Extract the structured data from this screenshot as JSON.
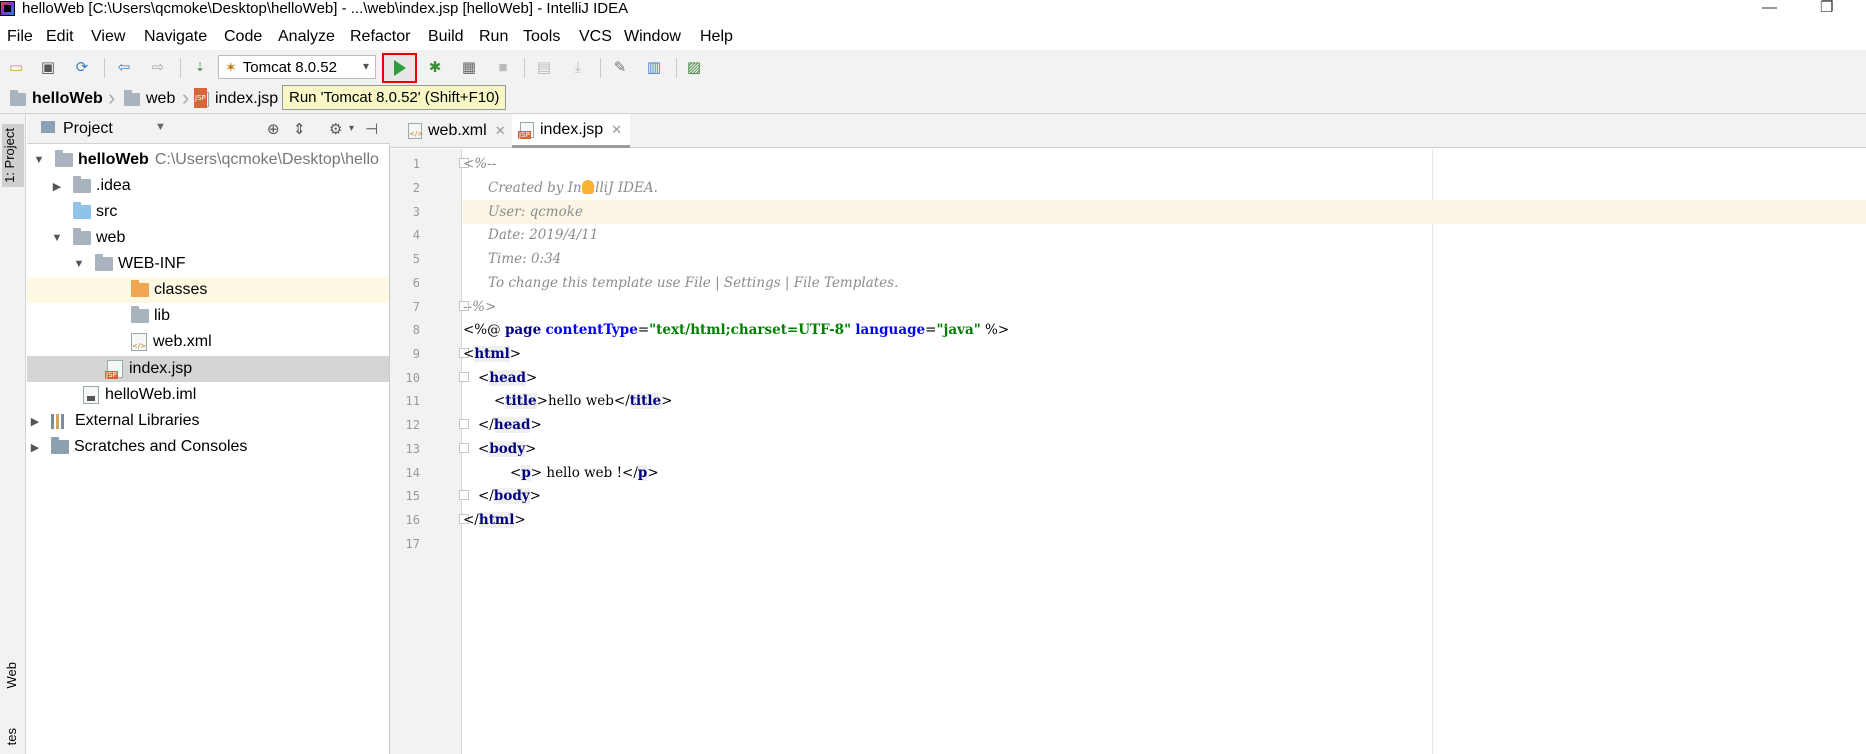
{
  "window": {
    "title": "helloWeb [C:\\Users\\qcmoke\\Desktop\\helloWeb] - ...\\web\\index.jsp [helloWeb] - IntelliJ IDEA",
    "minimize": "—",
    "restore": "❐"
  },
  "menu": [
    "File",
    "Edit",
    "View",
    "Navigate",
    "Code",
    "Analyze",
    "Refactor",
    "Build",
    "Run",
    "Tools",
    "VCS",
    "Window",
    "Help"
  ],
  "toolbar": {
    "run_config": "Tomcat 8.0.52",
    "tooltip": "Run 'Tomcat 8.0.52' (Shift+F10)"
  },
  "breadcrumb": [
    "helloWeb",
    "web",
    "index.jsp"
  ],
  "side_tabs": {
    "project": "1: Project",
    "web": "Web",
    "favorites": "tes"
  },
  "project_panel": {
    "title": "Project",
    "tree": [
      {
        "label": "helloWeb",
        "path": "C:\\Users\\qcmoke\\Desktop\\hello"
      },
      {
        "label": ".idea"
      },
      {
        "label": "src"
      },
      {
        "label": "web"
      },
      {
        "label": "WEB-INF"
      },
      {
        "label": "classes"
      },
      {
        "label": "lib"
      },
      {
        "label": "web.xml"
      },
      {
        "label": "index.jsp"
      },
      {
        "label": "helloWeb.iml"
      },
      {
        "label": "External Libraries"
      },
      {
        "label": "Scratches and Consoles"
      }
    ]
  },
  "editor": {
    "tabs": [
      {
        "label": "web.xml"
      },
      {
        "label": "index.jsp"
      }
    ],
    "line_numbers": [
      "1",
      "2",
      "3",
      "4",
      "5",
      "6",
      "7",
      "8",
      "9",
      "10",
      "11",
      "12",
      "13",
      "14",
      "15",
      "16",
      "17"
    ],
    "code": {
      "l1": "<%--",
      "l2": "Created by IntelliJ IDEA.",
      "l3": "User: qcmoke",
      "l4": "Date: 2019/4/11",
      "l5": "Time: 0:34",
      "l6": "To change this template use File | Settings | File Templates.",
      "l7": "--%>",
      "l8": {
        "open": "<%@ ",
        "dir": "page",
        "a1": "contentType",
        "eq1": "=",
        "v1": "\"text/html;charset=UTF-8\"",
        "a2": "language",
        "eq2": "=",
        "v2": "\"java\"",
        "close": " %>"
      },
      "html_tag": "html",
      "head_tag": "head",
      "title_tag": "title",
      "title_text": "hello web",
      "body_tag": "body",
      "p_tag": "p",
      "p_text": " hello web !"
    }
  }
}
